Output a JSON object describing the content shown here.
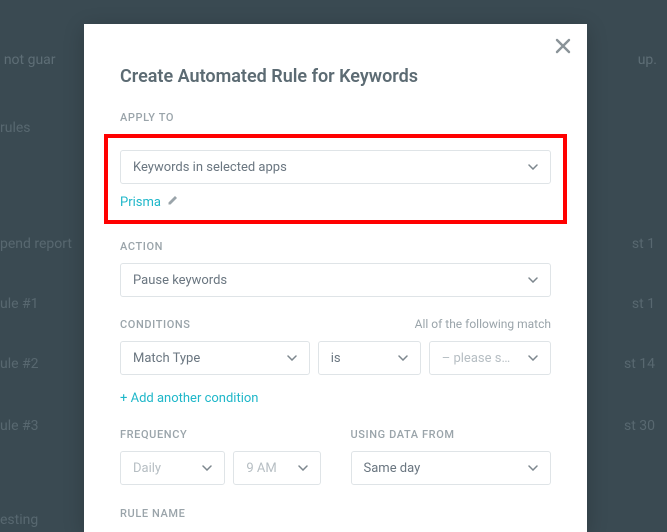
{
  "background": {
    "top_left": "s are not guar",
    "top_right": "up.",
    "left_items": [
      "rules",
      "pend report",
      "ule #1",
      "ule #2",
      "ule #3",
      "esting"
    ],
    "right_items": [
      "st 1",
      "st 1",
      "st 14",
      "st 30"
    ]
  },
  "modal": {
    "title": "Create Automated Rule for Keywords",
    "apply_to": {
      "label": "APPLY TO",
      "value": "Keywords in selected apps",
      "app_name": "Prisma"
    },
    "action": {
      "label": "ACTION",
      "value": "Pause keywords"
    },
    "conditions": {
      "label": "CONDITIONS",
      "hint": "All of the following match",
      "field": "Match Type",
      "operator": "is",
      "value": "– please s…",
      "add_label": "+ Add another condition"
    },
    "frequency": {
      "label": "FREQUENCY",
      "period": "Daily",
      "time": "9 AM"
    },
    "data_from": {
      "label": "USING DATA FROM",
      "value": "Same day"
    },
    "rule_name": {
      "label": "RULE NAME"
    }
  }
}
